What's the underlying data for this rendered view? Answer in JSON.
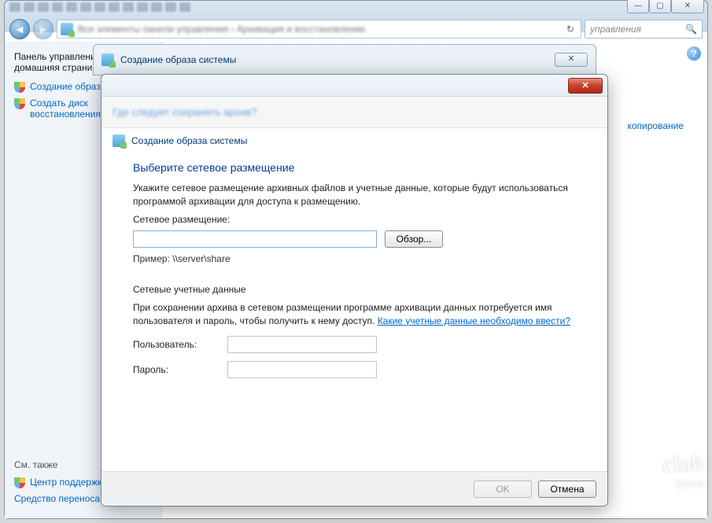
{
  "outer": {
    "addr_blur": "Все элементы панели управления  ›  Архивация и восстановление",
    "search_placeholder": "управления",
    "winbuttons": {
      "min": "—",
      "max": "▢",
      "close": "✕"
    }
  },
  "sidebar": {
    "title": "Панель управления — домашняя страница",
    "links": [
      "Создание образа системы",
      "Создать диск восстановления системы"
    ],
    "see_also_label": "См. также",
    "bottom_links": [
      "Центр поддержки",
      "Средство переноса данных Windows"
    ]
  },
  "main": {
    "right_link": "копирование"
  },
  "mid_window": {
    "title": "Создание образа системы",
    "close_glyph": "✕"
  },
  "dialog": {
    "title": "Создание образа системы",
    "close_glyph": "✕",
    "subhead_blur": "Где следует сохранять архив?",
    "sub_title": "Создание образа системы",
    "heading": "Выберите сетевое размещение",
    "intro": "Укажите сетевое размещение архивных файлов и учетные данные, которые будут использоваться программой архивации для доступа к размещению.",
    "location_label": "Сетевое размещение:",
    "location_value": "",
    "browse": "Обзор...",
    "example": "Пример: \\\\server\\share",
    "creds_label": "Сетевые учетные данные",
    "creds_intro_a": "При сохранении архива в сетевом размещении программе архивации данных потребуется имя пользователя и пароль, чтобы получить к нему доступ. ",
    "creds_link": "Какие учетные данные необходимо ввести?",
    "user_label": "Пользователь:",
    "pass_label": "Пароль:",
    "ok": "OK",
    "cancel": "Отмена"
  },
  "watermark": {
    "top": "club",
    "bottom": "Sovet"
  }
}
